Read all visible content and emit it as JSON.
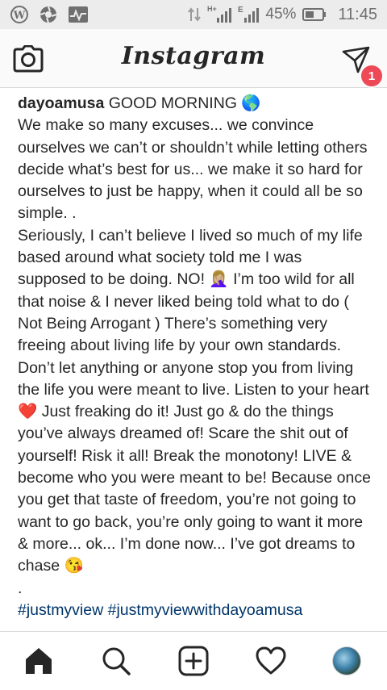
{
  "status_bar": {
    "battery_percent": "45%",
    "time": "11:45",
    "network_label": "H+",
    "icons": [
      "wordpress-icon",
      "aperture-icon",
      "activity-monitor-icon",
      "data-transfer-icon",
      "signal-icon",
      "signal-e-icon",
      "battery-icon"
    ]
  },
  "header": {
    "logo_text": "Instagram",
    "dm_badge_count": "1",
    "badge_color": "#ed4956"
  },
  "post": {
    "username": "dayoamusa",
    "caption": " GOOD MORNING 🌎\nWe make so many excuses... we convince ourselves we can’t or shouldn’t while letting others decide what’s best for us... we make it so hard for ourselves to just be happy, when it could all be so simple. .\nSeriously, I can’t believe I lived so much of my life based around what society told me I was supposed to be doing. NO! 🤦🏼‍♀️ I’m too wild for all that noise & I never liked being told what to do ( Not Being Arrogant ) There’s something very freeing about living life by your own standards. Don’t let anything or anyone stop you from living the life you were meant to live. Listen to your heart ❤️ Just freaking do it! Just go & do the things you’ve always dreamed of! Scare the shit out of yourself! Risk it all! Break the monotony! LIVE & become who you were meant to be! Because once you get that taste of freedom, you’re not going to want to go back, you’re only going to want it more & more... ok... I’m done now... I’ve got dreams to chase 😘\n.",
    "hashtags": "#justmyview #justmyviewwithdayoamusa",
    "hashtag_color": "#003569"
  },
  "bottom_nav": {
    "items": [
      "home-icon",
      "search-icon",
      "new-post-icon",
      "activity-heart-icon",
      "profile-avatar"
    ]
  }
}
